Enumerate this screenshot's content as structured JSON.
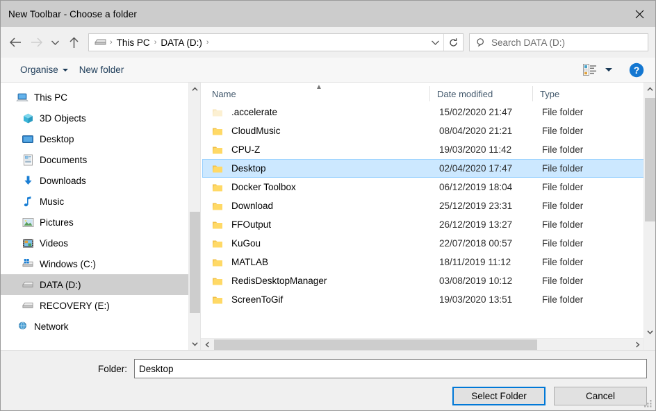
{
  "window": {
    "title": "New Toolbar - Choose a folder",
    "close_icon": "close-icon"
  },
  "nav": {
    "back_label": "Back",
    "forward_label": "Forward",
    "recent_label": "Recent locations",
    "up_label": "Up",
    "refresh_label": "Refresh",
    "breadcrumb": [
      "This PC",
      "DATA (D:)"
    ],
    "breadcrumb_separator": "›",
    "search_placeholder": "Search DATA (D:)"
  },
  "toolbar": {
    "organise_label": "Organise",
    "new_folder_label": "New folder",
    "view_icon": "details-view-icon",
    "help_label": "?"
  },
  "sidebar": {
    "items": [
      {
        "label": "This PC",
        "icon": "computer-icon",
        "level": 0,
        "selected": false
      },
      {
        "label": "3D Objects",
        "icon": "cube-icon",
        "level": 1,
        "selected": false
      },
      {
        "label": "Desktop",
        "icon": "desktop-icon",
        "level": 1,
        "selected": false
      },
      {
        "label": "Documents",
        "icon": "documents-icon",
        "level": 1,
        "selected": false
      },
      {
        "label": "Downloads",
        "icon": "downloads-icon",
        "level": 1,
        "selected": false
      },
      {
        "label": "Music",
        "icon": "music-icon",
        "level": 1,
        "selected": false
      },
      {
        "label": "Pictures",
        "icon": "pictures-icon",
        "level": 1,
        "selected": false
      },
      {
        "label": "Videos",
        "icon": "videos-icon",
        "level": 1,
        "selected": false
      },
      {
        "label": "Windows (C:)",
        "icon": "windows-drive-icon",
        "level": 1,
        "selected": false
      },
      {
        "label": "DATA (D:)",
        "icon": "drive-icon",
        "level": 1,
        "selected": true
      },
      {
        "label": "RECOVERY (E:)",
        "icon": "drive-icon",
        "level": 1,
        "selected": false
      },
      {
        "label": "Network",
        "icon": "network-icon",
        "level": 0,
        "selected": false
      }
    ]
  },
  "filelist": {
    "columns": [
      "Name",
      "Date modified",
      "Type"
    ],
    "sort_column": "Name",
    "sort_direction": "ascending",
    "rows": [
      {
        "name": ".accelerate",
        "date": "15/02/2020 21:47",
        "type": "File folder",
        "selected": false,
        "dimmed": true
      },
      {
        "name": "CloudMusic",
        "date": "08/04/2020 21:21",
        "type": "File folder",
        "selected": false,
        "dimmed": false
      },
      {
        "name": "CPU-Z",
        "date": "19/03/2020 11:42",
        "type": "File folder",
        "selected": false,
        "dimmed": false
      },
      {
        "name": "Desktop",
        "date": "02/04/2020 17:47",
        "type": "File folder",
        "selected": true,
        "dimmed": false
      },
      {
        "name": "Docker Toolbox",
        "date": "06/12/2019 18:04",
        "type": "File folder",
        "selected": false,
        "dimmed": false
      },
      {
        "name": "Download",
        "date": "25/12/2019 23:31",
        "type": "File folder",
        "selected": false,
        "dimmed": false
      },
      {
        "name": "FFOutput",
        "date": "26/12/2019 13:27",
        "type": "File folder",
        "selected": false,
        "dimmed": false
      },
      {
        "name": "KuGou",
        "date": "22/07/2018 00:57",
        "type": "File folder",
        "selected": false,
        "dimmed": false
      },
      {
        "name": "MATLAB",
        "date": "18/11/2019 11:12",
        "type": "File folder",
        "selected": false,
        "dimmed": false
      },
      {
        "name": "RedisDesktopManager",
        "date": "03/08/2019 10:12",
        "type": "File folder",
        "selected": false,
        "dimmed": false
      },
      {
        "name": "ScreenToGif",
        "date": "19/03/2020 13:51",
        "type": "File folder",
        "selected": false,
        "dimmed": false
      }
    ]
  },
  "footer": {
    "folder_label": "Folder:",
    "folder_value": "Desktop",
    "select_button": "Select Folder",
    "cancel_button": "Cancel"
  },
  "colors": {
    "accent": "#0078d7",
    "selection": "#cce8ff",
    "selection_border": "#99d1ff",
    "titlebar": "#cccccc",
    "chrome": "#f0f0f0",
    "folder_yellow": "#ffd966"
  }
}
